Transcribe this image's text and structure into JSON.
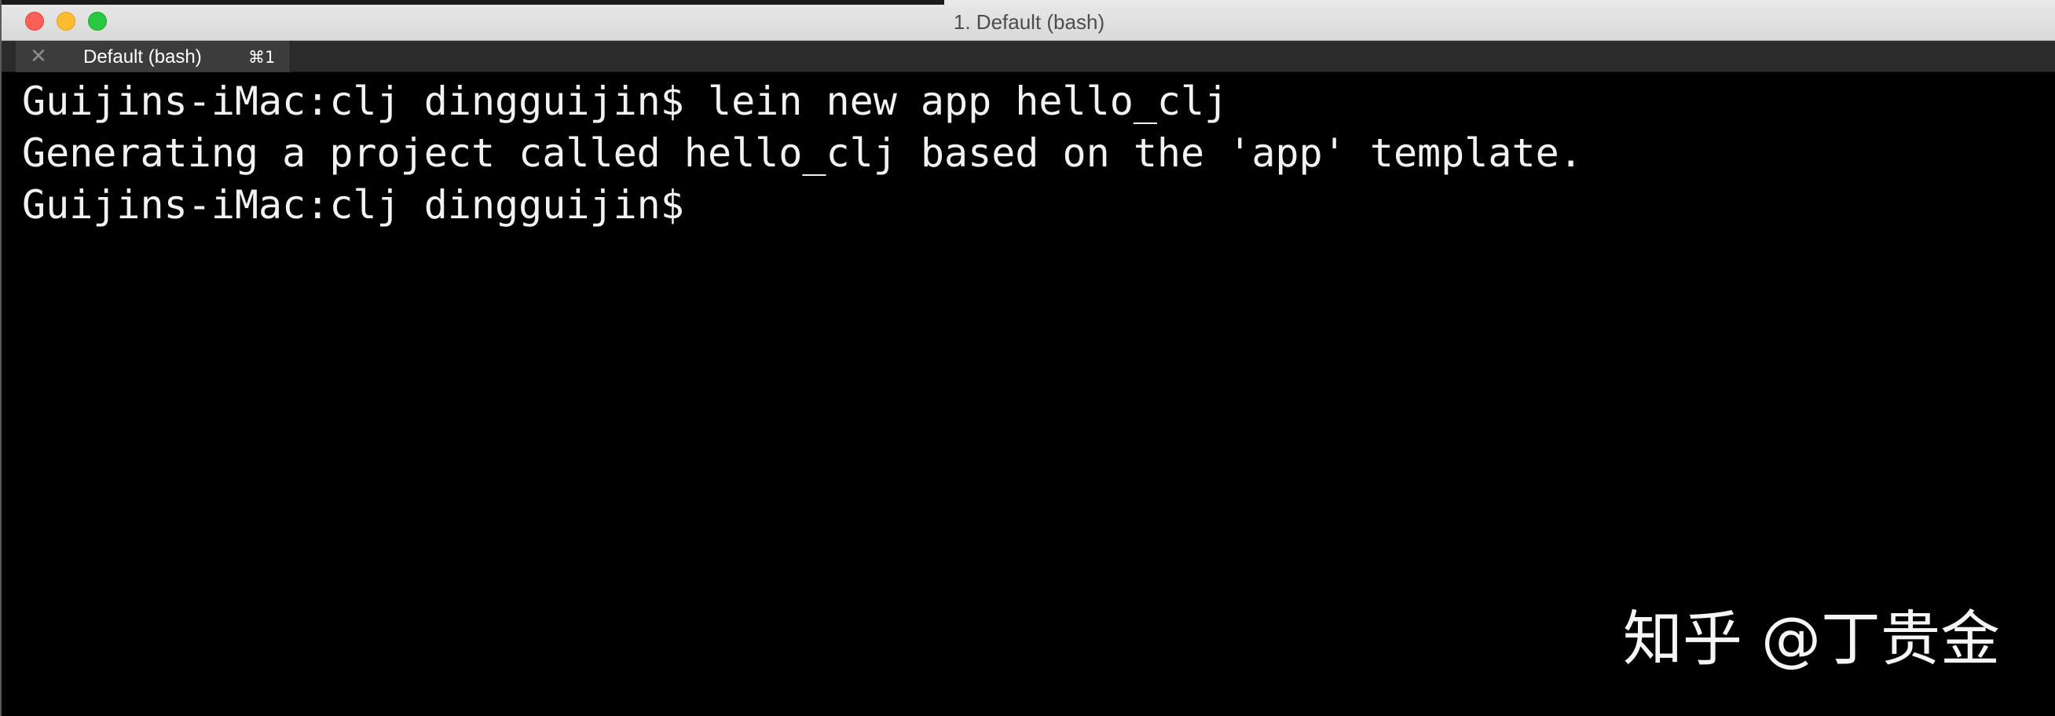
{
  "window": {
    "title": "1. Default (bash)"
  },
  "tab": {
    "close_glyph": "✕",
    "label": "Default (bash)",
    "shortcut": "⌘1"
  },
  "terminal": {
    "lines": [
      "Guijins-iMac:clj dingguijin$ lein new app hello_clj",
      "Generating a project called hello_clj based on the 'app' template.",
      "Guijins-iMac:clj dingguijin$"
    ]
  },
  "watermark": {
    "text": "知乎 @丁贵金"
  },
  "colors": {
    "close": "#fe5f57",
    "minimize": "#febc2e",
    "zoom": "#28c840",
    "terminal_bg": "#000000",
    "terminal_fg": "#f2f2f2"
  }
}
